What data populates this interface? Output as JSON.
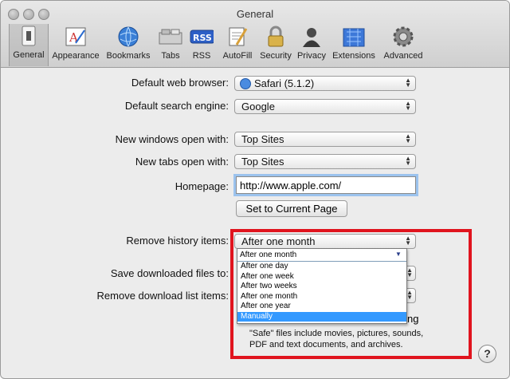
{
  "window": {
    "title": "General"
  },
  "toolbar": {
    "items": [
      {
        "label": "General",
        "icon": "general-switch-icon"
      },
      {
        "label": "Appearance",
        "icon": "appearance-icon"
      },
      {
        "label": "Bookmarks",
        "icon": "globe-icon"
      },
      {
        "label": "Tabs",
        "icon": "tabs-icon"
      },
      {
        "label": "RSS",
        "icon": "rss-icon",
        "badge": "RSS"
      },
      {
        "label": "AutoFill",
        "icon": "autofill-icon"
      },
      {
        "label": "Security",
        "icon": "lock-icon"
      },
      {
        "label": "Privacy",
        "icon": "privacy-person-icon"
      },
      {
        "label": "Extensions",
        "icon": "extensions-icon"
      },
      {
        "label": "Advanced",
        "icon": "gear-icon"
      }
    ]
  },
  "settings": {
    "default_browser": {
      "label": "Default web browser:",
      "value": "Safari (5.1.2)"
    },
    "search_engine": {
      "label": "Default search engine:",
      "value": "Google"
    },
    "new_windows": {
      "label": "New windows open with:",
      "value": "Top Sites"
    },
    "new_tabs": {
      "label": "New tabs open with:",
      "value": "Top Sites"
    },
    "homepage": {
      "label": "Homepage:",
      "value": "http://www.apple.com/"
    },
    "set_current_button": "Set to Current Page",
    "remove_history": {
      "label": "Remove history items:",
      "value": "After one month"
    },
    "save_downloads": {
      "label": "Save downloaded files to:"
    },
    "remove_download_list": {
      "label": "Remove download list items:"
    },
    "open_safe_tail": "ng",
    "safe_note": "\"Safe\" files include movies, pictures, sounds, PDF and text documents, and archives."
  },
  "history_dropdown": {
    "selected": "After one month",
    "options": [
      "After one day",
      "After one week",
      "After two weeks",
      "After one month",
      "After one year",
      "Manually"
    ],
    "highlighted": "Manually"
  },
  "colors": {
    "highlight_box": "#e0141e",
    "selection": "#3399ff"
  }
}
